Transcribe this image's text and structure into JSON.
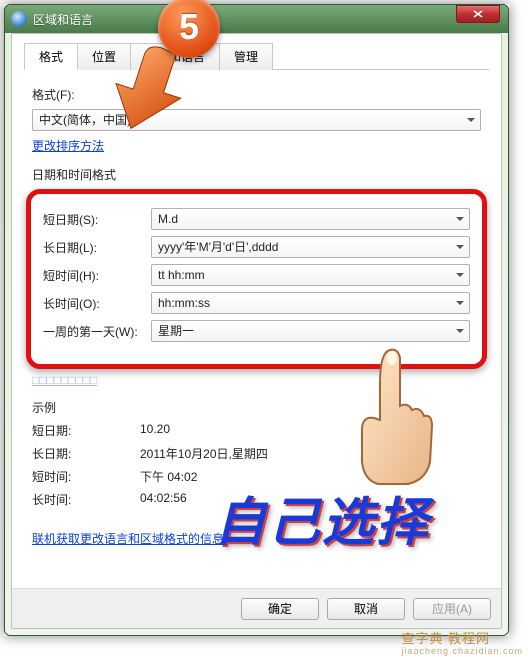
{
  "window": {
    "title": "区域和语言"
  },
  "tabs": [
    "格式",
    "位置",
    "键盘和语言",
    "管理"
  ],
  "format": {
    "label": "格式(F):",
    "value": "中文(简体，中国)",
    "sort_link": "更改排序方法"
  },
  "datetime_section": "日期和时间格式",
  "fields": {
    "short_date": {
      "label": "短日期(S):",
      "value": "M.d"
    },
    "long_date": {
      "label": "长日期(L):",
      "value": "yyyy'年'M'月'd'日',dddd"
    },
    "short_time": {
      "label": "短时间(H):",
      "value": "tt hh:mm"
    },
    "long_time": {
      "label": "长时间(O):",
      "value": "hh:mm:ss"
    },
    "first_day": {
      "label": "一周的第一天(W):",
      "value": "星期一"
    }
  },
  "truncated_link": "□□□□□□□□□",
  "examples": {
    "title": "示例",
    "short_date": {
      "label": "短日期:",
      "value": "10.20"
    },
    "long_date": {
      "label": "长日期:",
      "value": "2011年10月20日,星期四"
    },
    "short_time": {
      "label": "短时间:",
      "value": "下午 04:02"
    },
    "long_time": {
      "label": "长时间:",
      "value": "04:02:56"
    }
  },
  "bottom_link": "联机获取更改语言和区域格式的信息",
  "buttons": {
    "ok": "确定",
    "cancel": "取消",
    "apply": "应用(A)"
  },
  "overlay": {
    "badge": "5",
    "text": "自己选择"
  },
  "watermark": {
    "line1": "查字典 教程网",
    "line2": "jiaocheng.chazidian.com"
  }
}
